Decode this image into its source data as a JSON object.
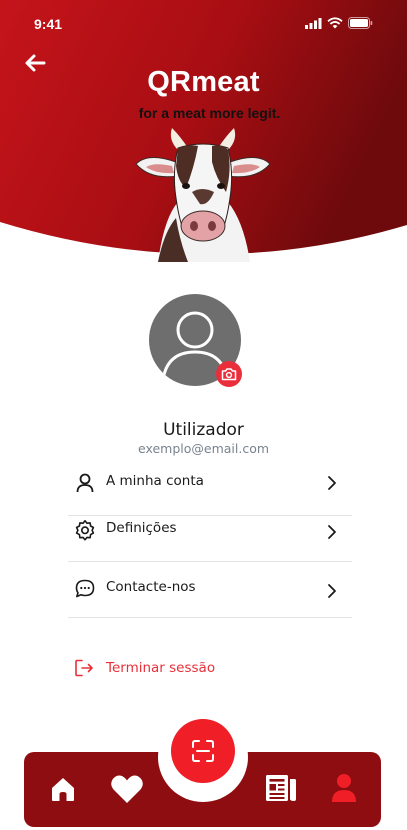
{
  "status_bar": {
    "time": "9:41"
  },
  "header": {
    "title": "QRmeat",
    "tagline": "for a meat more legit."
  },
  "profile": {
    "name": "Utilizador",
    "email": "exemplo@email.com"
  },
  "menu": {
    "items": [
      {
        "label": "A minha conta",
        "icon": "user-icon"
      },
      {
        "label": "Definições",
        "icon": "gear-icon"
      },
      {
        "label": "Contacte-nos",
        "icon": "chat-icon"
      }
    ]
  },
  "logout": {
    "label": "Terminar sessão",
    "icon": "logout-icon"
  },
  "bottom_nav": {
    "items": [
      "home-icon",
      "heart-icon",
      "scan-icon",
      "news-icon",
      "profile-icon"
    ],
    "active": "profile-icon"
  },
  "colors": {
    "brand_red": "#b50f14",
    "brand_dark": "#8e0d10",
    "accent": "#ef1e27"
  }
}
